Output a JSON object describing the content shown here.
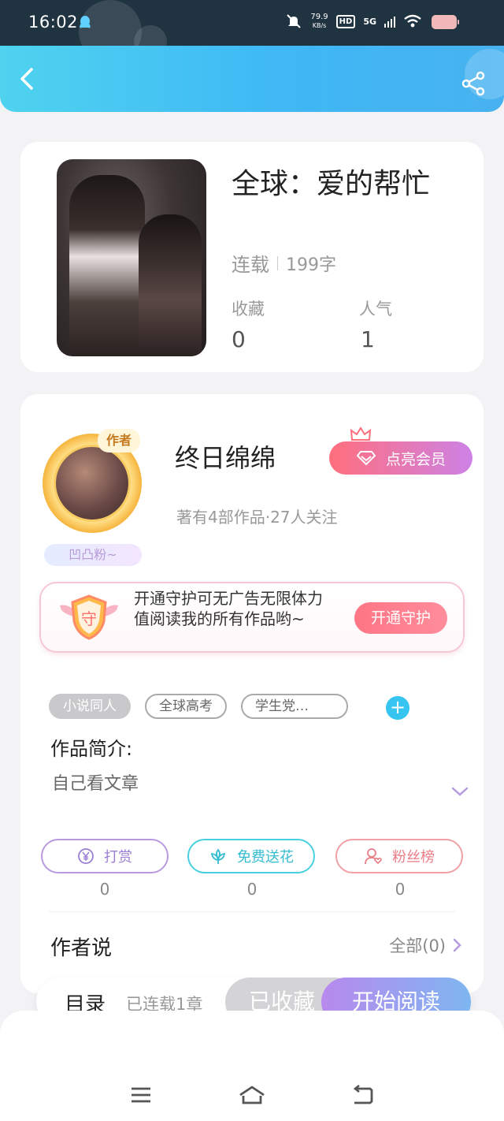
{
  "status_bar": {
    "time": "16:02",
    "net_speed_value": "79.9",
    "net_speed_unit": "KB/s",
    "hd": "HD",
    "network": "5G"
  },
  "book": {
    "title": "全球：爱的帮忙",
    "status": "连载",
    "word_count": "199字",
    "favorites_label": "收藏",
    "favorites_value": "0",
    "popularity_label": "人气",
    "popularity_value": "1"
  },
  "author": {
    "badge": "作者",
    "fan_badge": "凹凸粉~",
    "name": "终日绵绵",
    "info": "著有4部作品·27人关注",
    "vip_button": "点亮会员"
  },
  "guard": {
    "text": "开通守护可无广告无限体力值阅读我的所有作品哟~",
    "shield_char": "守",
    "button": "开通守护"
  },
  "tags": [
    "小说同人",
    "全球高考",
    "学生党…"
  ],
  "intro": {
    "label": "作品简介:",
    "text": "自己看文章"
  },
  "actions": [
    {
      "label": "打赏",
      "count": "0"
    },
    {
      "label": "免费送花",
      "count": "0"
    },
    {
      "label": "粉丝榜",
      "count": "0"
    }
  ],
  "author_say": {
    "label": "作者说",
    "all": "全部(0)"
  },
  "bottom_bar": {
    "catalog": "目录",
    "chapters": "已连载1章",
    "collected": "已收藏",
    "read": "开始阅读"
  },
  "colors": {
    "header_start": "#4fd3ef",
    "header_end": "#48b2f0",
    "accent_pink": "#ff6f7d",
    "accent_purple": "#b889ee",
    "accent_blue": "#36c4f0"
  }
}
